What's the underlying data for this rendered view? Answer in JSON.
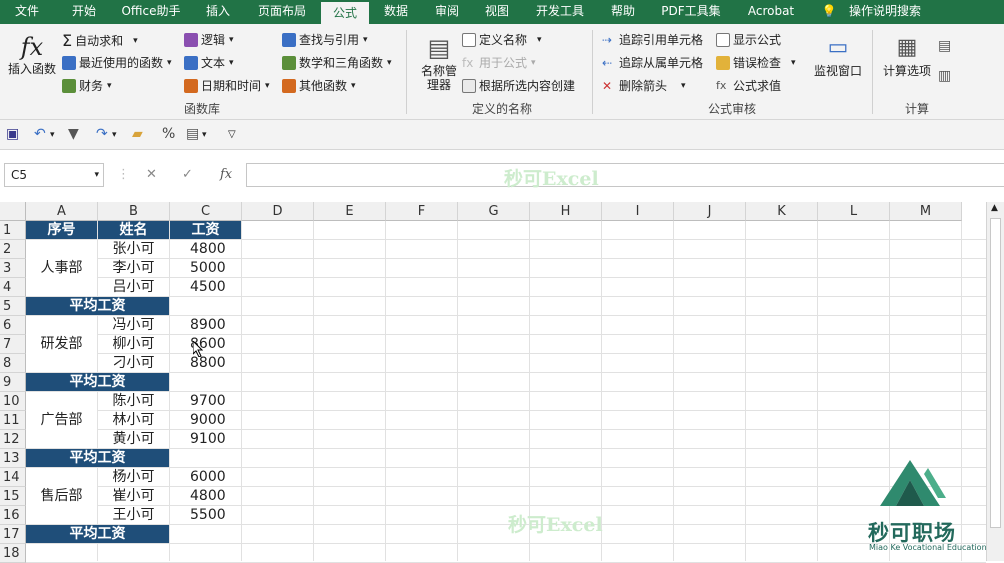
{
  "tabs": [
    "文件",
    "开始",
    "Office助手",
    "插入",
    "页面布局",
    "公式",
    "数据",
    "审阅",
    "视图",
    "开发工具",
    "帮助",
    "PDF工具集",
    "Acrobat",
    "操作说明搜索"
  ],
  "ribbon": {
    "insert_function": "插入函数",
    "autosum": "自动求和",
    "recent": "最近使用的函数",
    "finance": "财务",
    "logic": "逻辑",
    "text": "文本",
    "datetime": "日期和时间",
    "lookup": "查找与引用",
    "math": "数学和三角函数",
    "other": "其他函数",
    "group_library": "函数库",
    "name_manager": "名称管理器",
    "define_name": "定义名称",
    "use_in_formula": "用于公式",
    "create_from_sel": "根据所选内容创建",
    "group_names": "定义的名称",
    "trace_prec": "追踪引用单元格",
    "trace_dep": "追踪从属单元格",
    "remove_arrows": "删除箭头",
    "show_formulas": "显示公式",
    "error_check": "错误检查",
    "evaluate": "公式求值",
    "group_audit": "公式审核",
    "watch": "监视窗口",
    "calc_options": "计算选项",
    "group_calc": "计算"
  },
  "namebox": "C5",
  "fx": "fx",
  "watermark": "秒可Excel",
  "columns": [
    "A",
    "B",
    "C",
    "D",
    "E",
    "F",
    "G",
    "H",
    "I",
    "J",
    "K",
    "L",
    "M"
  ],
  "rows": [
    "1",
    "2",
    "3",
    "4",
    "5",
    "6",
    "7",
    "8",
    "9",
    "10",
    "11",
    "12",
    "13",
    "14",
    "15",
    "16",
    "17",
    "18"
  ],
  "header": {
    "a": "序号",
    "b": "姓名",
    "c": "工资"
  },
  "avg_label": "平均工资",
  "depts": [
    "人事部",
    "研发部",
    "广告部",
    "售后部"
  ],
  "names": [
    "张小可",
    "李小可",
    "吕小可",
    "冯小可",
    "柳小可",
    "刁小可",
    "陈小可",
    "林小可",
    "黄小可",
    "杨小可",
    "崔小可",
    "王小可"
  ],
  "salaries": [
    "4800",
    "5000",
    "4500",
    "8900",
    "8600",
    "8800",
    "9700",
    "9000",
    "9100",
    "6000",
    "4800",
    "5500"
  ],
  "logo": {
    "title": "秒可职场",
    "subtitle": "Miao Ke Vocational Education"
  },
  "colors": {
    "excel_green": "#217346",
    "header_fill": "#1f4e79",
    "logo_green": "#23695c"
  }
}
